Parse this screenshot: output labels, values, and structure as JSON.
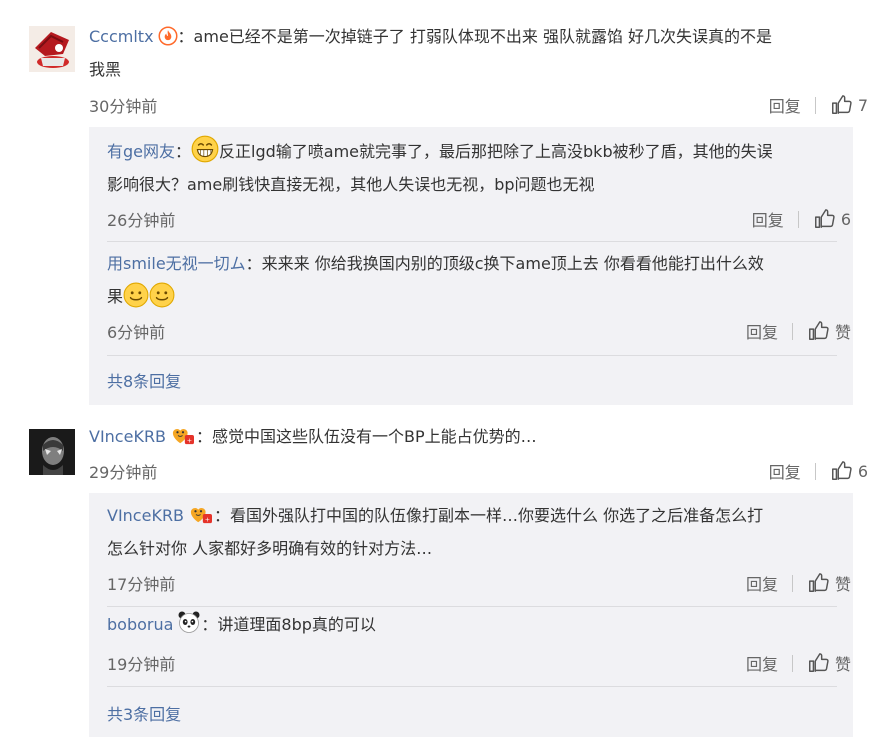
{
  "comments": [
    {
      "user": "Cccmltx",
      "text_line1": "：ame已经不是第一次掉链子了  打弱队体现不出来 强队就露馅   好几次失误真的不是",
      "text_line2": "我黑",
      "time": "30分钟前",
      "reply_label": "回复",
      "likes": "7",
      "replies": [
        {
          "user": "有ge网友",
          "text_line1": "反正lgd输了喷ame就完事了，最后那把除了上高没bkb被秒了盾，其他的失误",
          "text_line2": "影响很大？ame刷钱快直接无视，其他人失误也无视，bp问题也无视",
          "time": "26分钟前",
          "reply_label": "回复",
          "likes": "6"
        },
        {
          "user": "用smile无视一切ム",
          "text_line1": "：来来来 你给我换国内别的顶级c换下ame顶上去 你看看他能打出什么效",
          "text_line2": "果",
          "time": "6分钟前",
          "reply_label": "回复",
          "likes": "赞"
        }
      ],
      "more": "共8条回复"
    },
    {
      "user": "VInceKRB",
      "text_line1": "：感觉中国这些队伍没有一个BP上能占优势的…",
      "time": "29分钟前",
      "reply_label": "回复",
      "likes": "6",
      "replies": [
        {
          "user": "VInceKRB",
          "text_line1": "：看国外强队打中国的队伍像打副本一样…你要选什么 你选了之后准备怎么打",
          "text_line2": "怎么针对你 人家都好多明确有效的针对方法…",
          "time": "17分钟前",
          "reply_label": "回复",
          "likes": "赞"
        },
        {
          "user": "boborua",
          "text_line1": "：讲道理面8bp真的可以",
          "time": "19分钟前",
          "reply_label": "回复",
          "likes": "赞"
        }
      ],
      "more": "共3条回复"
    }
  ],
  "colors": {
    "link": "#4d6fa3",
    "text": "#333333",
    "meta": "#666666",
    "reply_bg": "#f2f2f5"
  }
}
